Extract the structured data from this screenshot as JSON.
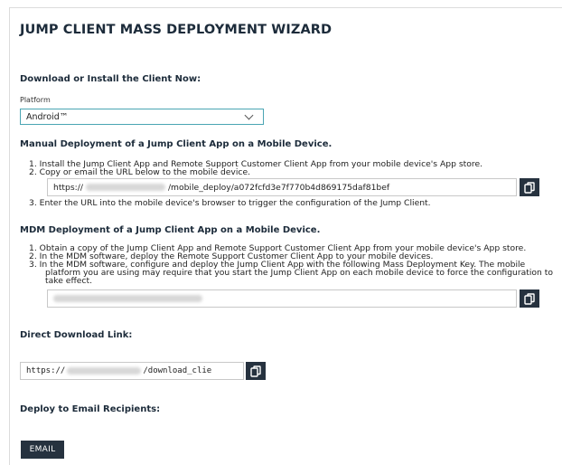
{
  "wizard": {
    "title": "JUMP CLIENT MASS DEPLOYMENT WIZARD"
  },
  "download_install": {
    "heading": "Download or Install the Client Now:",
    "platform_label": "Platform",
    "platform_value": "Android™"
  },
  "manual": {
    "heading": "Manual Deployment of a Jump Client App on a Mobile Device.",
    "steps": [
      "1. Install the Jump Client App and Remote Support Customer Client App from your mobile device's App store.",
      "2. Copy or email the URL below to the mobile device.",
      "3. Enter the URL into the mobile device's browser to trigger the configuration of the Jump Client."
    ],
    "url_prefix": "https://",
    "url_suffix": "/mobile_deploy/a072fcfd3e7f770b4d869175daf81bef"
  },
  "mdm": {
    "heading": "MDM Deployment of a Jump Client App on a Mobile Device.",
    "steps": [
      "1. Obtain a copy of the Jump Client App and Remote Support Customer Client App from your mobile device's App store.",
      "2. In the MDM software, deploy the Remote Support Customer Client App to your mobile devices.",
      "3. In the MDM software, configure and deploy the Jump Client App with the following Mass Deployment Key. The mobile",
      "platform you are using may require that you start the Jump Client App on each mobile device to force the configuration to",
      "take effect."
    ]
  },
  "direct": {
    "heading": "Direct Download Link:",
    "url_prefix": "https://",
    "url_suffix": "/download_clie"
  },
  "email": {
    "heading": "Deploy to Email Recipients:",
    "button_label": "EMAIL"
  },
  "colors": {
    "dark_button": "#26323f",
    "select_border": "#4aa5b3",
    "heading": "#1c2b3a"
  },
  "icons": {
    "copy": "copy-icon",
    "dropdown": "chevron-down-icon"
  }
}
